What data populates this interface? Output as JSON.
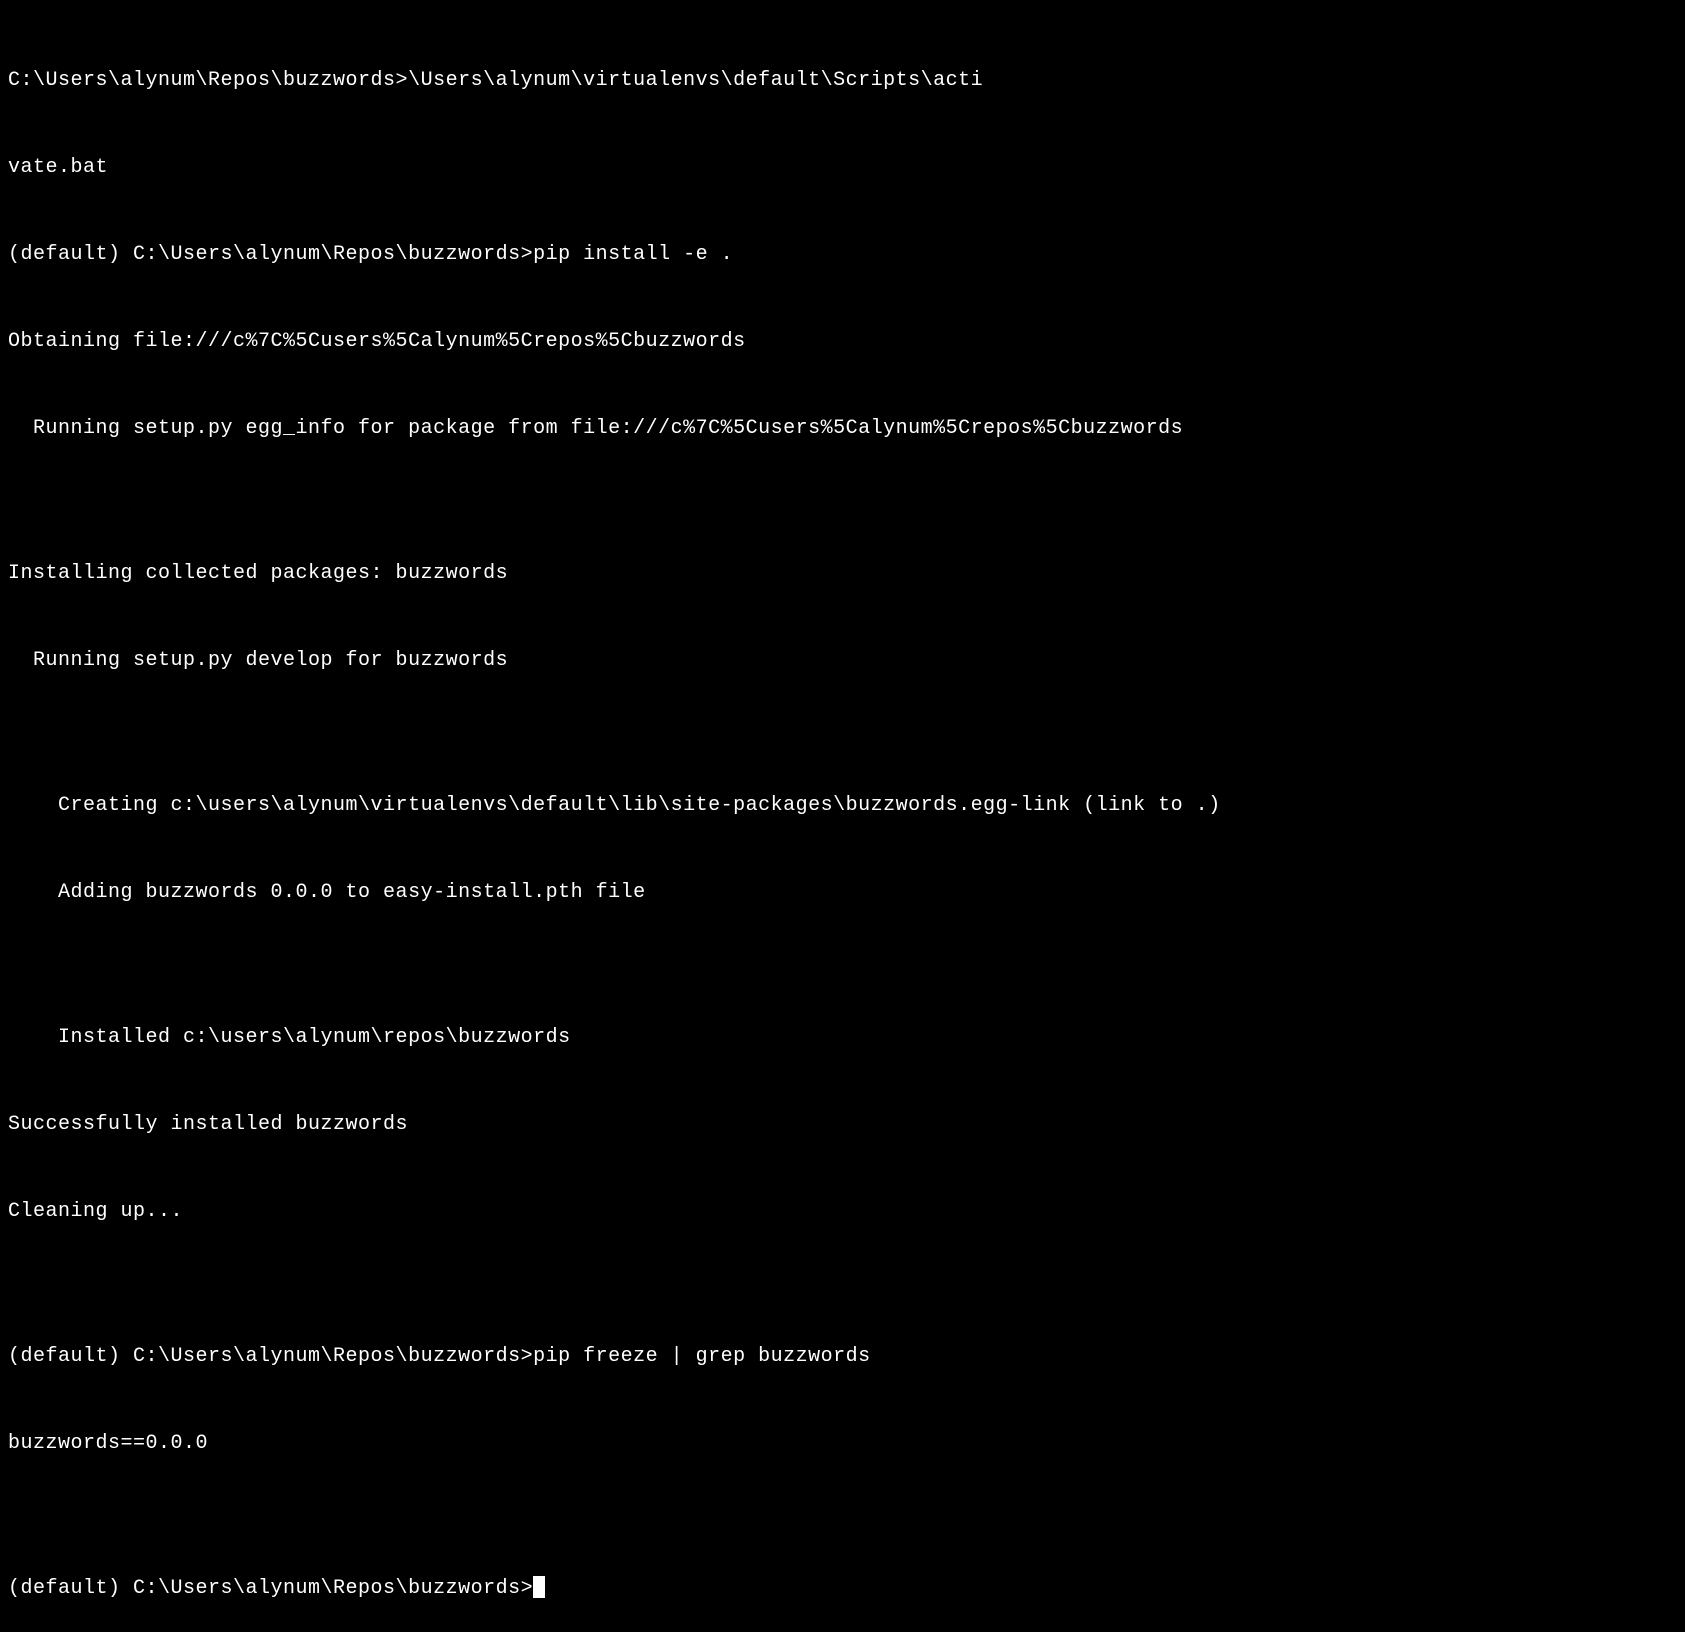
{
  "terminal": {
    "lines": [
      "C:\\Users\\alynum\\Repos\\buzzwords>\\Users\\alynum\\virtualenvs\\default\\Scripts\\acti",
      "vate.bat",
      "(default) C:\\Users\\alynum\\Repos\\buzzwords>pip install -e .",
      "Obtaining file:///c%7C%5Cusers%5Calynum%5Crepos%5Cbuzzwords",
      "  Running setup.py egg_info for package from file:///c%7C%5Cusers%5Calynum%5Crepos%5Cbuzzwords",
      "",
      "Installing collected packages: buzzwords",
      "  Running setup.py develop for buzzwords",
      "",
      "    Creating c:\\users\\alynum\\virtualenvs\\default\\lib\\site-packages\\buzzwords.egg-link (link to .)",
      "    Adding buzzwords 0.0.0 to easy-install.pth file",
      "",
      "    Installed c:\\users\\alynum\\repos\\buzzwords",
      "Successfully installed buzzwords",
      "Cleaning up...",
      "",
      "(default) C:\\Users\\alynum\\Repos\\buzzwords>pip freeze | grep buzzwords",
      "buzzwords==0.0.0",
      "",
      "(default) C:\\Users\\alynum\\Repos\\buzzwords>"
    ],
    "has_cursor": true
  }
}
